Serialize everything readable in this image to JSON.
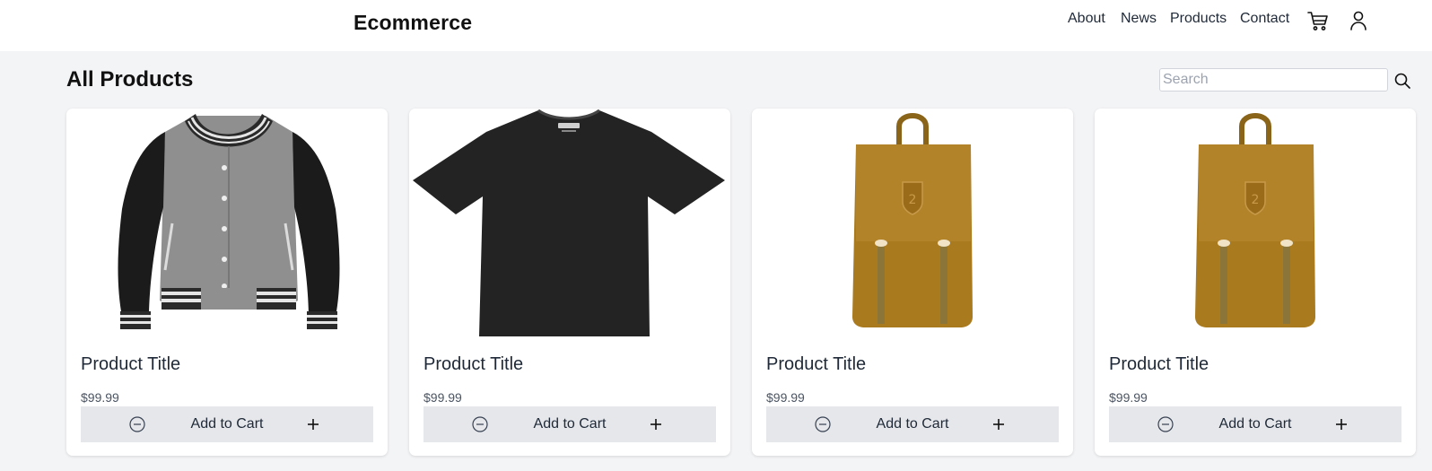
{
  "header": {
    "brand": "Ecommerce",
    "nav": [
      "About",
      "News",
      "Products",
      "Contact"
    ],
    "icons": [
      "cart-icon",
      "user-icon"
    ]
  },
  "main": {
    "title": "All Products",
    "search": {
      "placeholder": "Search",
      "value": ""
    }
  },
  "products": [
    {
      "image": "varsity-jacket",
      "title": "Product Title",
      "price": "$99.99",
      "action": "Add to Cart"
    },
    {
      "image": "black-tshirt",
      "title": "Product Title",
      "price": "$99.99",
      "action": "Add to Cart"
    },
    {
      "image": "mustard-backpack",
      "title": "Product Title",
      "price": "$99.99",
      "action": "Add to Cart"
    },
    {
      "image": "mustard-backpack",
      "title": "Product Title",
      "price": "$99.99",
      "action": "Add to Cart"
    }
  ],
  "colors": {
    "background": "#f3f4f6",
    "card": "#ffffff",
    "cart_bar": "#e5e7eb",
    "backpack": "#a97a1e"
  }
}
